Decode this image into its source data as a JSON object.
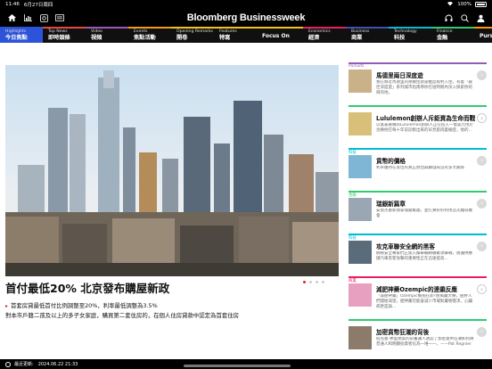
{
  "status": {
    "time": "11:46",
    "date": "6月27日周四",
    "battery": "100%"
  },
  "toolbar": {
    "brand": "Bloomberg Businessweek",
    "icons": [
      "home-icon",
      "chart-icon",
      "quote-icon",
      "list-icon",
      "headphones-icon",
      "search-icon",
      "profile-icon"
    ]
  },
  "tabs": [
    {
      "en": "Highlights",
      "zh": "今日焦點",
      "color": "#2d53d8"
    },
    {
      "en": "Top News",
      "zh": "即時頭條",
      "color": "#e54b3c"
    },
    {
      "en": "Video",
      "zh": "視頻",
      "color": "#9b59b6"
    },
    {
      "en": "Events",
      "zh": "焦點活動",
      "color": "#f39c12"
    },
    {
      "en": "Opening Remarks",
      "zh": "開卷",
      "color": "#f1c40f"
    },
    {
      "en": "Features",
      "zh": "特寫",
      "color": "#f1c40f"
    },
    {
      "en": "",
      "zh": "Focus On",
      "color": "#f1c40f"
    },
    {
      "en": "Economics",
      "zh": "經濟",
      "color": "#e91e63"
    },
    {
      "en": "Business",
      "zh": "商業",
      "color": "#3f51b5"
    },
    {
      "en": "Technology",
      "zh": "科技",
      "color": "#00bcd4"
    },
    {
      "en": "Finance",
      "zh": "金融",
      "color": "#2ecc71"
    },
    {
      "en": "",
      "zh": "Purs",
      "color": "#ff9800"
    }
  ],
  "hero": {
    "headline": "首付最低20% 北京發布購屋新政",
    "bullet1": "首套房貸最低首付比例調整至20%，利率最低調整為3.5%",
    "bullet2": "對本市戶籍二孩及以上的多子女家庭，購買第二套住房的，在個人住房貸款中認定為首套住房",
    "slides_total": 4,
    "slide_current": 1
  },
  "sidebar": [
    {
      "category": "Pursuits",
      "title": "馬德里兩日深度遊",
      "desc": "我在鄰近馬德里的德爾拉斯雷推度假村入住，有着「最佳深度遊」系列城市指南帶你在短時間內深入探索你的目的地，",
      "color": "#9b59b6",
      "arrow_white": false,
      "thumb": "#c9b28a"
    },
    {
      "category": "",
      "title": "Lululemon創辦人斥鉅資為生命而戰",
      "desc": "以富豪著稱的Lululemon創辦人正在投入一億美元用於治療他在每十年前診斷出來的罕見肌肉萎縮症，他的…",
      "color": "#2ecc71",
      "arrow_white": true,
      "thumb": "#d9c07a"
    },
    {
      "category": "科技",
      "title": "貨幣的價格",
      "desc": "利率維持在高位的真正原因與聯儲局沒有多大關係",
      "color": "#00bcd4",
      "arrow_white": false,
      "thumb": "#7fb6d6"
    },
    {
      "category": "金融",
      "title": "瑞銀新篇章",
      "desc": "安恩杰重新執掌瑞銀集團，並打算好好利用這次難得機會",
      "color": "#2ecc71",
      "arrow_white": false,
      "thumb": "#9aa7b3"
    },
    {
      "category": "科技",
      "title": "攻克車聯安全網的黑客",
      "desc": "網絡安全專家們正加入攔車輛網聯聚攻擊戰，防護供應鏈汽車黑客攻擊的重要性正在迅速提高…",
      "color": "#00bcd4",
      "arrow_white": false,
      "thumb": "#5a6b7a"
    },
    {
      "category": "商業",
      "title": "減肥神藥Ozempic的連鎖反應",
      "desc": "「減肥神藥」Ozempic擁抱在即?防風藥大樂，肥胖人們開始渴望，肥神藥可能會減少市場對藥物需求，心臟病更是與...",
      "color": "#e91e63",
      "arrow_white": true,
      "thumb": "#e8a0c0"
    },
    {
      "category": "",
      "title": "加密貨幣狂潮的背後",
      "desc": "班克曼-弗里德案的前董議人透認了加密貨幣狂潮如何將普通人和明顯投資者化為一堆一一，——Pat Regnier",
      "color": "#2ecc71",
      "arrow_white": false,
      "thumb": "#8c7b6a"
    }
  ],
  "footer": {
    "label": "最近更新:",
    "updated": "2024.06.22 21:33"
  }
}
